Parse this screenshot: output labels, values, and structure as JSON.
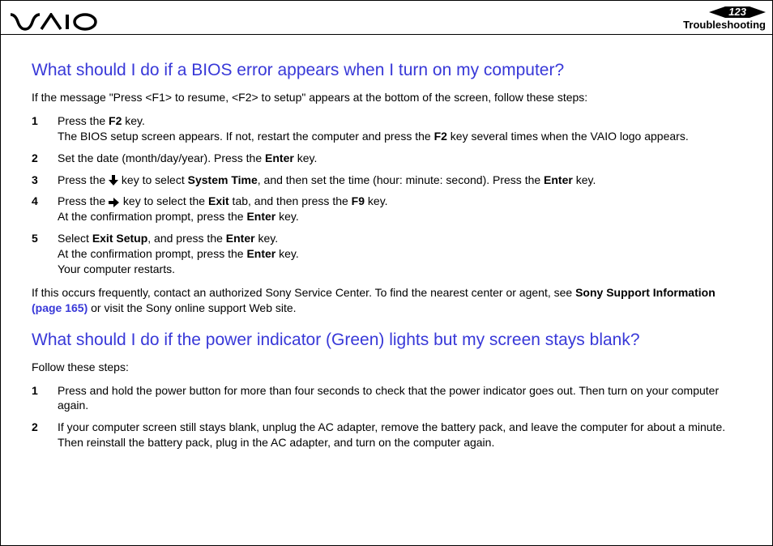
{
  "header": {
    "page_number": "123",
    "section": "Troubleshooting"
  },
  "section1": {
    "heading": "What should I do if a BIOS error appears when I turn on my computer?",
    "intro": "If the message \"Press <F1> to resume, <F2> to setup\" appears at the bottom of the screen, follow these steps:",
    "steps": {
      "s1a": "Press the ",
      "s1b": "F2",
      "s1c": " key.",
      "s1d": "The BIOS setup screen appears. If not, restart the computer and press the ",
      "s1e": "F2",
      "s1f": " key several times when the VAIO logo appears.",
      "s2a": "Set the date (month/day/year). Press the ",
      "s2b": "Enter",
      "s2c": " key.",
      "s3a": "Press the ",
      "s3b": " key to select ",
      "s3c": "System Time",
      "s3d": ", and then set the time (hour: minute: second). Press the ",
      "s3e": "Enter",
      "s3f": " key.",
      "s4a": "Press the ",
      "s4b": " key to select the ",
      "s4c": "Exit",
      "s4d": " tab, and then press the ",
      "s4e": "F9",
      "s4f": " key.",
      "s4g": "At the confirmation prompt, press the ",
      "s4h": "Enter",
      "s4i": " key.",
      "s5a": "Select ",
      "s5b": "Exit Setup",
      "s5c": ", and press the ",
      "s5d": "Enter",
      "s5e": " key.",
      "s5f": "At the confirmation prompt, press the ",
      "s5g": "Enter",
      "s5h": " key.",
      "s5i": "Your computer restarts."
    },
    "outro_a": "If this occurs frequently, contact an authorized Sony Service Center. To find the nearest center or agent, see ",
    "outro_b": "Sony Support Information ",
    "outro_link": "(page 165)",
    "outro_c": " or visit the Sony online support Web site."
  },
  "section2": {
    "heading": "What should I do if the power indicator (Green) lights but my screen stays blank?",
    "intro": "Follow these steps:",
    "steps": {
      "s1": "Press and hold the power button for more than four seconds to check that the power indicator goes out. Then turn on your computer again.",
      "s2": "If your computer screen still stays blank, unplug the AC adapter, remove the battery pack, and leave the computer for about a minute. Then reinstall the battery pack, plug in the AC adapter, and turn on the computer again."
    }
  }
}
